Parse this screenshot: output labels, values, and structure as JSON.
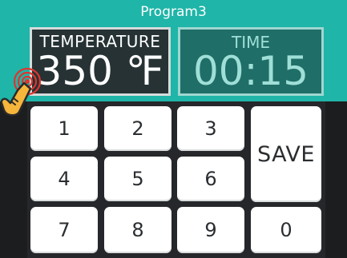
{
  "header": {
    "program_title": "Program3",
    "temperature_label": "TEMPERATURE",
    "temperature_value": "350 ℉",
    "time_label": "TIME",
    "time_value": "00:15"
  },
  "keypad": {
    "keys": [
      "1",
      "2",
      "3",
      "4",
      "5",
      "6",
      "7",
      "8",
      "9",
      "0"
    ],
    "save_label": "SAVE"
  },
  "colors": {
    "accent": "#1fb5a8",
    "temp_box": "#263234",
    "time_box": "#1f6e67",
    "keypad_bg": "#25272a"
  },
  "icons": [
    "tap-gesture-icon"
  ]
}
